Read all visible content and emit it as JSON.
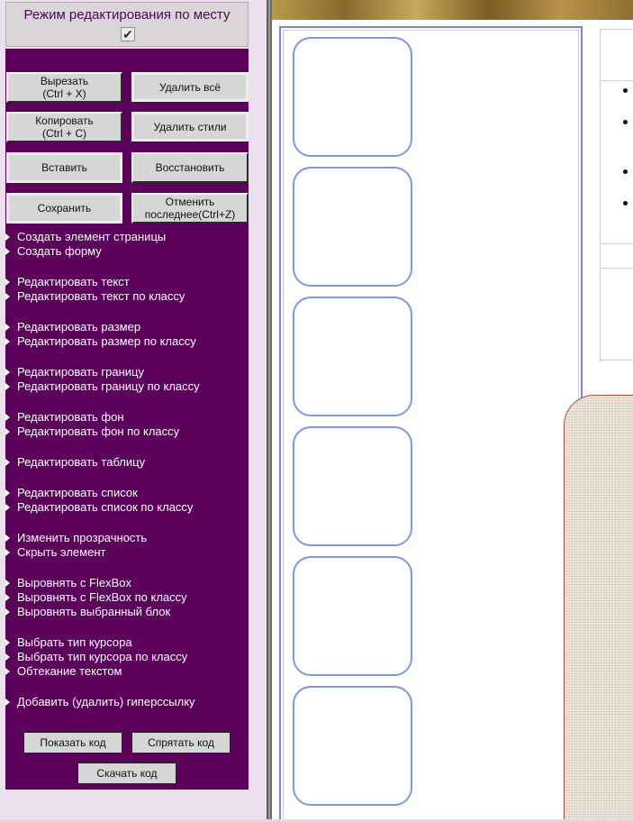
{
  "panel": {
    "title": "Режим редактирования по месту",
    "checkbox_checked": true,
    "buttons": {
      "cut": "Вырезать\n(Ctrl + X)",
      "delete_all": "Удалить всё",
      "copy": "Копировать\n(Ctrl + C)",
      "delete_styles": "Удалить стили",
      "paste": "Вставить",
      "restore": "Восстановить",
      "save": "Сохранить",
      "undo": "Отменить\nпоследнее(Ctrl+Z)"
    },
    "menu": [
      "Создать элемент страницы",
      "Создать форму",
      "Редактировать текст",
      "Редактировать текст по классу",
      "Редактировать размер",
      "Редактировать размер по классу",
      "Редактировать границу",
      "Редактировать границу по классу",
      "Редактировать фон",
      "Редактировать фон по классу",
      "Редактировать таблицу",
      "Редактировать список",
      "Редактировать список по классу",
      "Изменить прозрачность",
      "Скрыть элемент",
      "Выровнять с FlexBox",
      "Выровнять с FlexBox по классу",
      "Выровнять выбранный блок",
      "Выбрать тип курсора",
      "Выбрать тип курсора по классу",
      "Обтекание текстом",
      "Добавить (удалить) гиперссылку"
    ],
    "footer": {
      "show_code": "Показать код",
      "hide_code": "Спрятать код",
      "download_code": "Скачать код"
    }
  },
  "preview": {
    "card_count": 6,
    "list_bullet_count": 4
  },
  "colors": {
    "panel_bg": "#5c005c",
    "page_bg": "#efe0ef",
    "card_border": "#7f95e6",
    "column_border": "#7f7fe0"
  },
  "icons": {
    "menu_bullet": "triangle-right-icon",
    "checkbox": "checkmark-icon"
  }
}
